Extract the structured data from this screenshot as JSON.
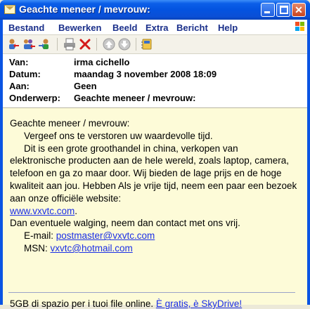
{
  "window": {
    "title": "Geachte meneer / mevrouw:"
  },
  "menu": [
    "Bestand",
    "Bewerken",
    "Beeld",
    "Extra",
    "Bericht",
    "Help"
  ],
  "toolbar": {
    "icons": [
      "reply-icon",
      "reply-all-icon",
      "forward-icon",
      "print-icon",
      "delete-icon",
      "previous-icon",
      "next-icon",
      "address-book-icon"
    ]
  },
  "header": {
    "from_label": "Van:",
    "from_value": "irma cichello",
    "date_label": "Datum:",
    "date_value": "maandag 3 november 2008 18:09",
    "to_label": "Aan:",
    "to_value": "Geen",
    "subject_label": "Onderwerp:",
    "subject_value": "Geachte meneer / mevrouw:"
  },
  "message": {
    "greeting": "Geachte meneer / mevrouw:",
    "line1": "Vergeef ons te verstoren uw waardevolle tijd.",
    "para1_start": "Dit is een grote groothandel in china, verkopen van",
    "para1_rest": "elektronische producten aan de hele wereld, zoals laptop, camera, telefoon en ga zo maar door. Wij bieden de lage prijs en de hoge kwaliteit aan jou. Hebben Als je vrije tijd, neem een paar een bezoek aan onze officiële website:",
    "website": "www.vxvtc.com",
    "website_suffix": ".",
    "contact_line": "Dan eventuele walging, neem dan contact met ons vrij.",
    "email_label": "E-mail:",
    "email": "postmaster@vxvtc.com",
    "msn_label": "MSN:",
    "msn": "vxvtc@hotmail.com"
  },
  "footer": {
    "text": "5GB di spazio per i tuoi file online.",
    "link": "È gratis, è SkyDrive!"
  }
}
